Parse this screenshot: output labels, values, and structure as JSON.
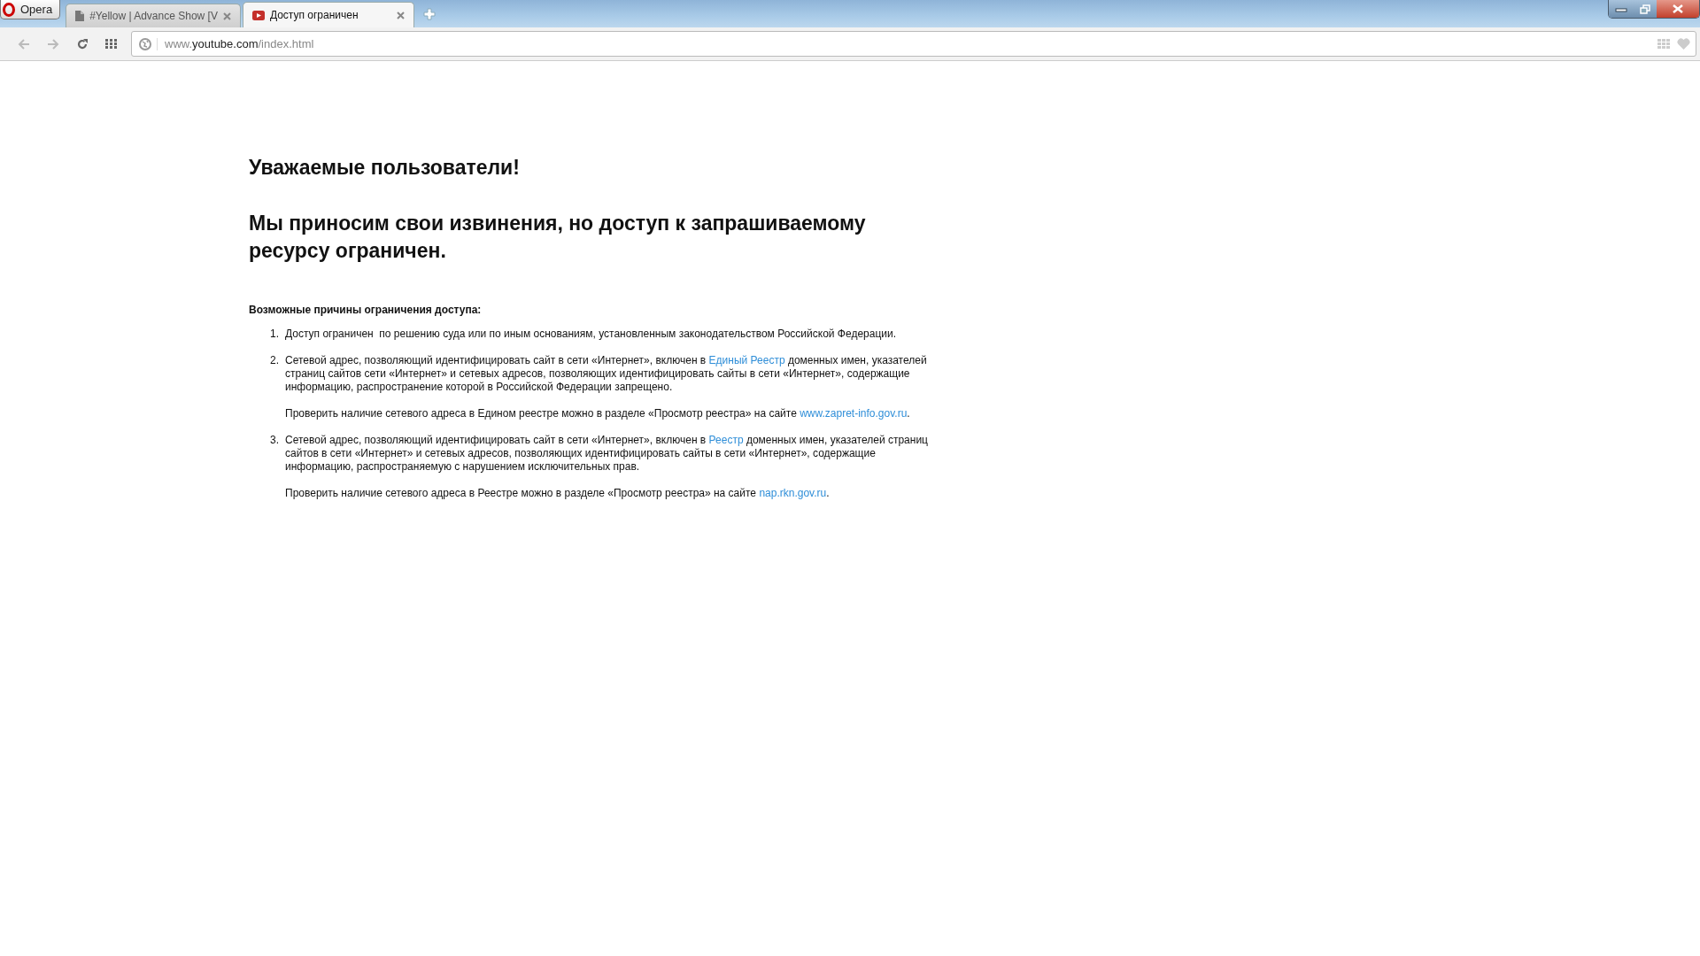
{
  "browser": {
    "menu_button": "Opera",
    "tabs": [
      {
        "title": "#Yellow | Advance Show [V",
        "selected": false,
        "kind": "page"
      },
      {
        "title": "Доступ ограничен",
        "selected": true,
        "kind": "video"
      }
    ],
    "address": {
      "host_prefix": "www.",
      "host": "youtube.com",
      "path": "/index.html"
    }
  },
  "page": {
    "greeting": "Уважаемые пользователи!",
    "heading": "Мы приносим свои извинения, но доступ к запрашиваемому ресурсу ограничен.",
    "reasons_title": "Возможные причины ограничения доступа:",
    "reasons": [
      {
        "number": "1.",
        "before": "Доступ ограничен  по решению суда или по иным основаниям, установленным законодательством Российской Федерации."
      },
      {
        "number": "2.",
        "before": "Сетевой адрес, позволяющий идентифицировать сайт в сети «Интернет», включен в ",
        "link": "Единый Реестр",
        "after": " доменных имен, указателей страниц сайтов сети «Интернет» и сетевых адресов, позволяющих идентифицировать сайты в сети «Интернет», содержащие информацию, распространение которой в Российской Федерации запрещено.",
        "note": {
          "before": "Проверить наличие сетевого адреса в Едином реестре можно в разделе «Просмотр реестра» на сайте ",
          "link": "www.zapret-info.gov.ru",
          "after": "."
        }
      },
      {
        "number": "3.",
        "before": "Сетевой адрес, позволяющий идентифицировать сайт в сети «Интернет», включен в ",
        "link": "Реестр",
        "after": " доменных имен, указателей страниц сайтов в сети «Интернет» и сетевых адресов, позволяющих идентифицировать сайты в сети «Интернет», содержащие информацию, распространяемую с нарушением исключительных прав.",
        "note": {
          "before": "Проверить наличие сетевого адреса в Реестре можно в разделе «Просмотр реестра» на сайте ",
          "link": "nap.rkn.gov.ru",
          "after": "."
        }
      }
    ]
  }
}
